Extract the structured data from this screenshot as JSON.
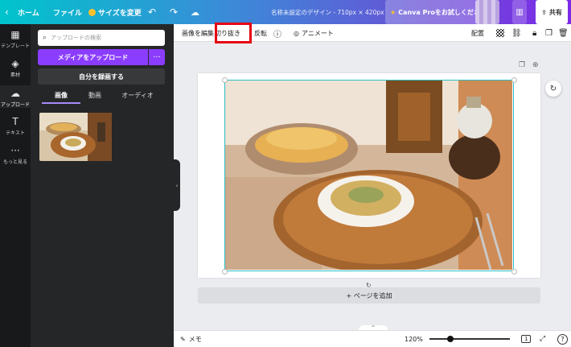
{
  "topbar": {
    "back_icon": "chevron-left-icon",
    "home": "ホーム",
    "file": "ファイル",
    "resize": "サイズを変更",
    "title": "名称未設定のデザイン - 710px × 420px",
    "pro": "Canva Proをお試しください",
    "share": "共有"
  },
  "rail": [
    {
      "label": "テンプレート",
      "icon": "template-icon"
    },
    {
      "label": "素材",
      "icon": "shapes-icon"
    },
    {
      "label": "アップロード",
      "icon": "upload-cloud-icon"
    },
    {
      "label": "テキスト",
      "icon": "text-icon"
    },
    {
      "label": "もっと見る",
      "icon": "more-icon"
    }
  ],
  "panel": {
    "search_placeholder": "アップロードの検索",
    "upload_button": "メディアをアップロード",
    "more_button": "···",
    "record_button": "自分を録画する",
    "tabs": [
      "画像",
      "動画",
      "オーディオ"
    ]
  },
  "context_toolbar": {
    "edit_image": "画像を編集",
    "crop": "切り抜き",
    "flip": "反転",
    "animate": "アニメート",
    "position": "配置"
  },
  "canvas": {
    "add_page": "+ ページを追加"
  },
  "bottom": {
    "memo": "メモ",
    "zoom": "120%",
    "page_number": "1",
    "help": "?"
  },
  "colors": {
    "accent": "#8b3dff",
    "highlight": "#e60012",
    "selection": "#2bc0c8"
  }
}
